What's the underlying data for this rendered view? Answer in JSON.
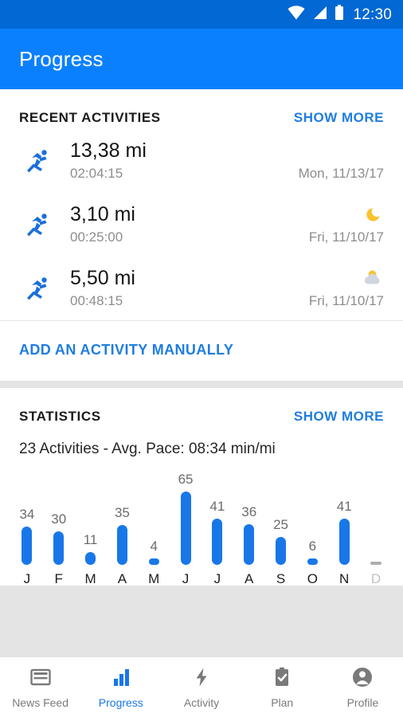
{
  "status_bar": {
    "time": "12:30",
    "icons": [
      "wifi-icon",
      "cellular-signal-icon",
      "battery-icon"
    ],
    "background": "#0168d4"
  },
  "app_bar": {
    "title": "Progress",
    "background": "#0b80ff"
  },
  "recent_activities": {
    "section_title": "RECENT ACTIVITIES",
    "show_more_label": "SHOW MORE",
    "add_manual_label": "ADD AN ACTIVITY MANUALLY",
    "items": [
      {
        "icon": "running-icon",
        "distance": "13,38 mi",
        "duration": "02:04:15",
        "date": "Mon, 11/13/17",
        "weather": "none"
      },
      {
        "icon": "running-icon",
        "distance": "3,10 mi",
        "duration": "00:25:00",
        "date": "Fri, 11/10/17",
        "weather": "moon-icon"
      },
      {
        "icon": "running-icon",
        "distance": "5,50 mi",
        "duration": "00:48:15",
        "date": "Fri, 11/10/17",
        "weather": "sun-behind-cloud-icon"
      }
    ]
  },
  "statistics": {
    "section_title": "STATISTICS",
    "show_more_label": "SHOW MORE",
    "summary": "23 Activities - Avg. Pace: 08:34 min/mi"
  },
  "chart_data": {
    "type": "bar",
    "title": "",
    "xlabel": "",
    "ylabel": "",
    "categories": [
      "J",
      "F",
      "M",
      "A",
      "M",
      "J",
      "J",
      "A",
      "S",
      "O",
      "N",
      "D"
    ],
    "values": [
      34,
      30,
      11,
      35,
      4,
      65,
      41,
      36,
      25,
      6,
      41,
      0
    ],
    "value_labels": [
      "34",
      "30",
      "11",
      "35",
      "4",
      "65",
      "41",
      "36",
      "25",
      "6",
      "41",
      ""
    ],
    "ylim": [
      0,
      65
    ],
    "grid": false,
    "legend": "none",
    "bar_color": "#1877e8",
    "empty_bar_color": "#aeaeae",
    "muted_categories": [
      "D"
    ]
  },
  "bottom_nav": {
    "active": "Progress",
    "items": [
      {
        "label": "News Feed",
        "icon": "news-feed-icon",
        "active": false
      },
      {
        "label": "Progress",
        "icon": "bar-chart-icon",
        "active": true
      },
      {
        "label": "Activity",
        "icon": "lightning-bolt-icon",
        "active": false
      },
      {
        "label": "Plan",
        "icon": "clipboard-check-icon",
        "active": false
      },
      {
        "label": "Profile",
        "icon": "person-circle-icon",
        "active": false
      }
    ]
  },
  "colors": {
    "accent": "#1877e8",
    "link": "#1f7de0",
    "app_bar": "#0b80ff",
    "status_bar": "#0168d4",
    "moon": "#f9c22e",
    "muted_text": "#8d8d8d"
  }
}
